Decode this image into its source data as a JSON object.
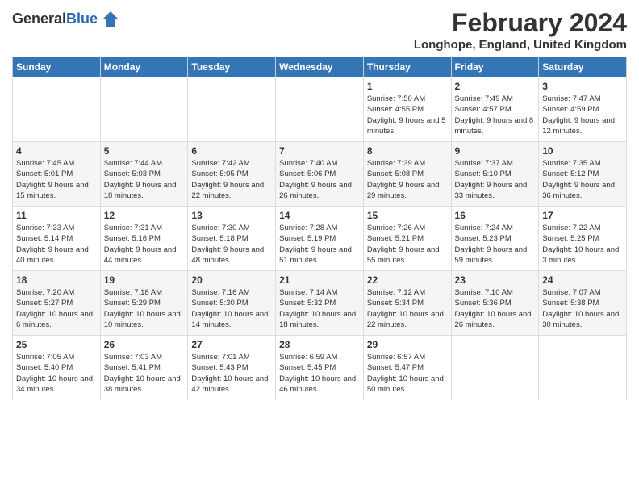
{
  "header": {
    "logo_general": "General",
    "logo_blue": "Blue",
    "month_title": "February 2024",
    "location": "Longhope, England, United Kingdom"
  },
  "weekdays": [
    "Sunday",
    "Monday",
    "Tuesday",
    "Wednesday",
    "Thursday",
    "Friday",
    "Saturday"
  ],
  "weeks": [
    [
      {
        "day": "",
        "info": ""
      },
      {
        "day": "",
        "info": ""
      },
      {
        "day": "",
        "info": ""
      },
      {
        "day": "",
        "info": ""
      },
      {
        "day": "1",
        "info": "Sunrise: 7:50 AM\nSunset: 4:55 PM\nDaylight: 9 hours\nand 5 minutes."
      },
      {
        "day": "2",
        "info": "Sunrise: 7:49 AM\nSunset: 4:57 PM\nDaylight: 9 hours\nand 8 minutes."
      },
      {
        "day": "3",
        "info": "Sunrise: 7:47 AM\nSunset: 4:59 PM\nDaylight: 9 hours\nand 12 minutes."
      }
    ],
    [
      {
        "day": "4",
        "info": "Sunrise: 7:45 AM\nSunset: 5:01 PM\nDaylight: 9 hours\nand 15 minutes."
      },
      {
        "day": "5",
        "info": "Sunrise: 7:44 AM\nSunset: 5:03 PM\nDaylight: 9 hours\nand 18 minutes."
      },
      {
        "day": "6",
        "info": "Sunrise: 7:42 AM\nSunset: 5:05 PM\nDaylight: 9 hours\nand 22 minutes."
      },
      {
        "day": "7",
        "info": "Sunrise: 7:40 AM\nSunset: 5:06 PM\nDaylight: 9 hours\nand 26 minutes."
      },
      {
        "day": "8",
        "info": "Sunrise: 7:39 AM\nSunset: 5:08 PM\nDaylight: 9 hours\nand 29 minutes."
      },
      {
        "day": "9",
        "info": "Sunrise: 7:37 AM\nSunset: 5:10 PM\nDaylight: 9 hours\nand 33 minutes."
      },
      {
        "day": "10",
        "info": "Sunrise: 7:35 AM\nSunset: 5:12 PM\nDaylight: 9 hours\nand 36 minutes."
      }
    ],
    [
      {
        "day": "11",
        "info": "Sunrise: 7:33 AM\nSunset: 5:14 PM\nDaylight: 9 hours\nand 40 minutes."
      },
      {
        "day": "12",
        "info": "Sunrise: 7:31 AM\nSunset: 5:16 PM\nDaylight: 9 hours\nand 44 minutes."
      },
      {
        "day": "13",
        "info": "Sunrise: 7:30 AM\nSunset: 5:18 PM\nDaylight: 9 hours\nand 48 minutes."
      },
      {
        "day": "14",
        "info": "Sunrise: 7:28 AM\nSunset: 5:19 PM\nDaylight: 9 hours\nand 51 minutes."
      },
      {
        "day": "15",
        "info": "Sunrise: 7:26 AM\nSunset: 5:21 PM\nDaylight: 9 hours\nand 55 minutes."
      },
      {
        "day": "16",
        "info": "Sunrise: 7:24 AM\nSunset: 5:23 PM\nDaylight: 9 hours\nand 59 minutes."
      },
      {
        "day": "17",
        "info": "Sunrise: 7:22 AM\nSunset: 5:25 PM\nDaylight: 10 hours\nand 3 minutes."
      }
    ],
    [
      {
        "day": "18",
        "info": "Sunrise: 7:20 AM\nSunset: 5:27 PM\nDaylight: 10 hours\nand 6 minutes."
      },
      {
        "day": "19",
        "info": "Sunrise: 7:18 AM\nSunset: 5:29 PM\nDaylight: 10 hours\nand 10 minutes."
      },
      {
        "day": "20",
        "info": "Sunrise: 7:16 AM\nSunset: 5:30 PM\nDaylight: 10 hours\nand 14 minutes."
      },
      {
        "day": "21",
        "info": "Sunrise: 7:14 AM\nSunset: 5:32 PM\nDaylight: 10 hours\nand 18 minutes."
      },
      {
        "day": "22",
        "info": "Sunrise: 7:12 AM\nSunset: 5:34 PM\nDaylight: 10 hours\nand 22 minutes."
      },
      {
        "day": "23",
        "info": "Sunrise: 7:10 AM\nSunset: 5:36 PM\nDaylight: 10 hours\nand 26 minutes."
      },
      {
        "day": "24",
        "info": "Sunrise: 7:07 AM\nSunset: 5:38 PM\nDaylight: 10 hours\nand 30 minutes."
      }
    ],
    [
      {
        "day": "25",
        "info": "Sunrise: 7:05 AM\nSunset: 5:40 PM\nDaylight: 10 hours\nand 34 minutes."
      },
      {
        "day": "26",
        "info": "Sunrise: 7:03 AM\nSunset: 5:41 PM\nDaylight: 10 hours\nand 38 minutes."
      },
      {
        "day": "27",
        "info": "Sunrise: 7:01 AM\nSunset: 5:43 PM\nDaylight: 10 hours\nand 42 minutes."
      },
      {
        "day": "28",
        "info": "Sunrise: 6:59 AM\nSunset: 5:45 PM\nDaylight: 10 hours\nand 46 minutes."
      },
      {
        "day": "29",
        "info": "Sunrise: 6:57 AM\nSunset: 5:47 PM\nDaylight: 10 hours\nand 50 minutes."
      },
      {
        "day": "",
        "info": ""
      },
      {
        "day": "",
        "info": ""
      }
    ]
  ]
}
